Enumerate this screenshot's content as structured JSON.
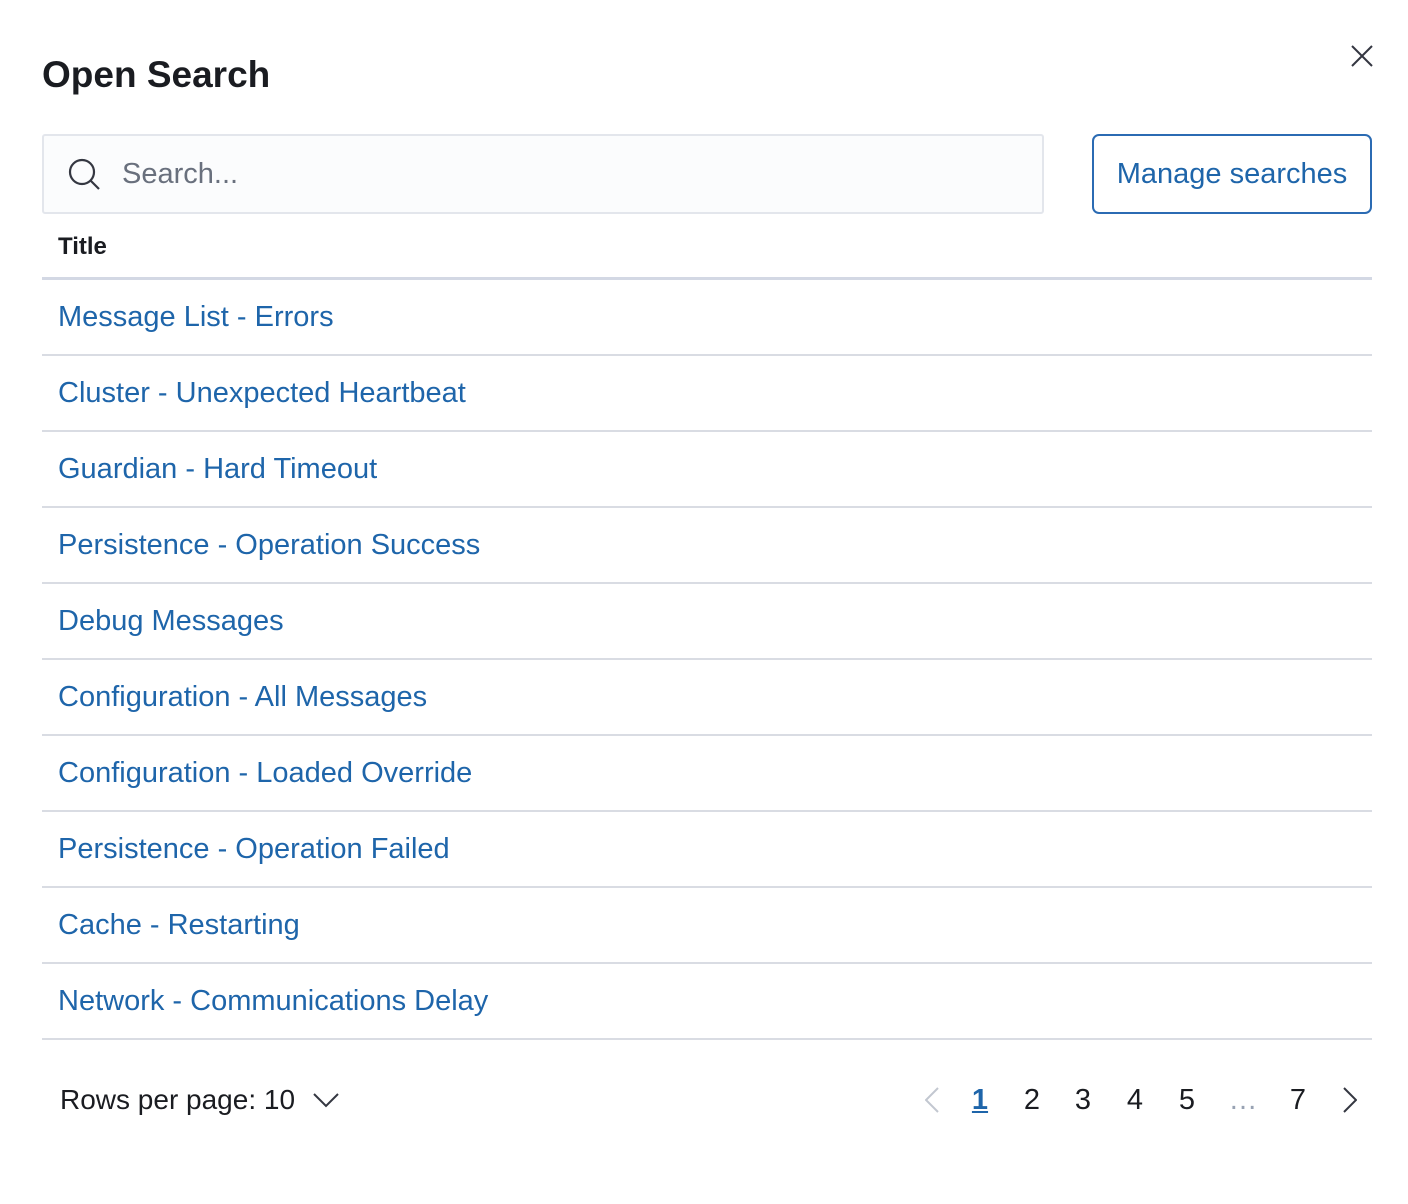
{
  "flyout": {
    "title": "Open Search"
  },
  "icons": {
    "close": "close-icon",
    "search": "search-icon",
    "rows_chevron": "chevron-down-icon",
    "prev": "chevron-left-icon",
    "next": "chevron-right-icon"
  },
  "search": {
    "placeholder": "Search...",
    "value": ""
  },
  "actions": {
    "manage_label": "Manage searches"
  },
  "table": {
    "column_title": "Title",
    "rows": [
      "Message List - Errors",
      "Cluster - Unexpected Heartbeat",
      "Guardian - Hard Timeout",
      "Persistence - Operation Success",
      "Debug Messages",
      "Configuration - All Messages",
      "Configuration - Loaded Override",
      "Persistence - Operation Failed",
      "Cache - Restarting",
      "Network - Communications Delay"
    ]
  },
  "pagination": {
    "rows_per_page_label": "Rows per page: 10",
    "pages": [
      "1",
      "2",
      "3",
      "4",
      "5",
      "…",
      "7"
    ],
    "current_page": "1"
  },
  "colors": {
    "link": "#1e65aa",
    "text": "#1a1c21",
    "border": "#d9dce3"
  }
}
